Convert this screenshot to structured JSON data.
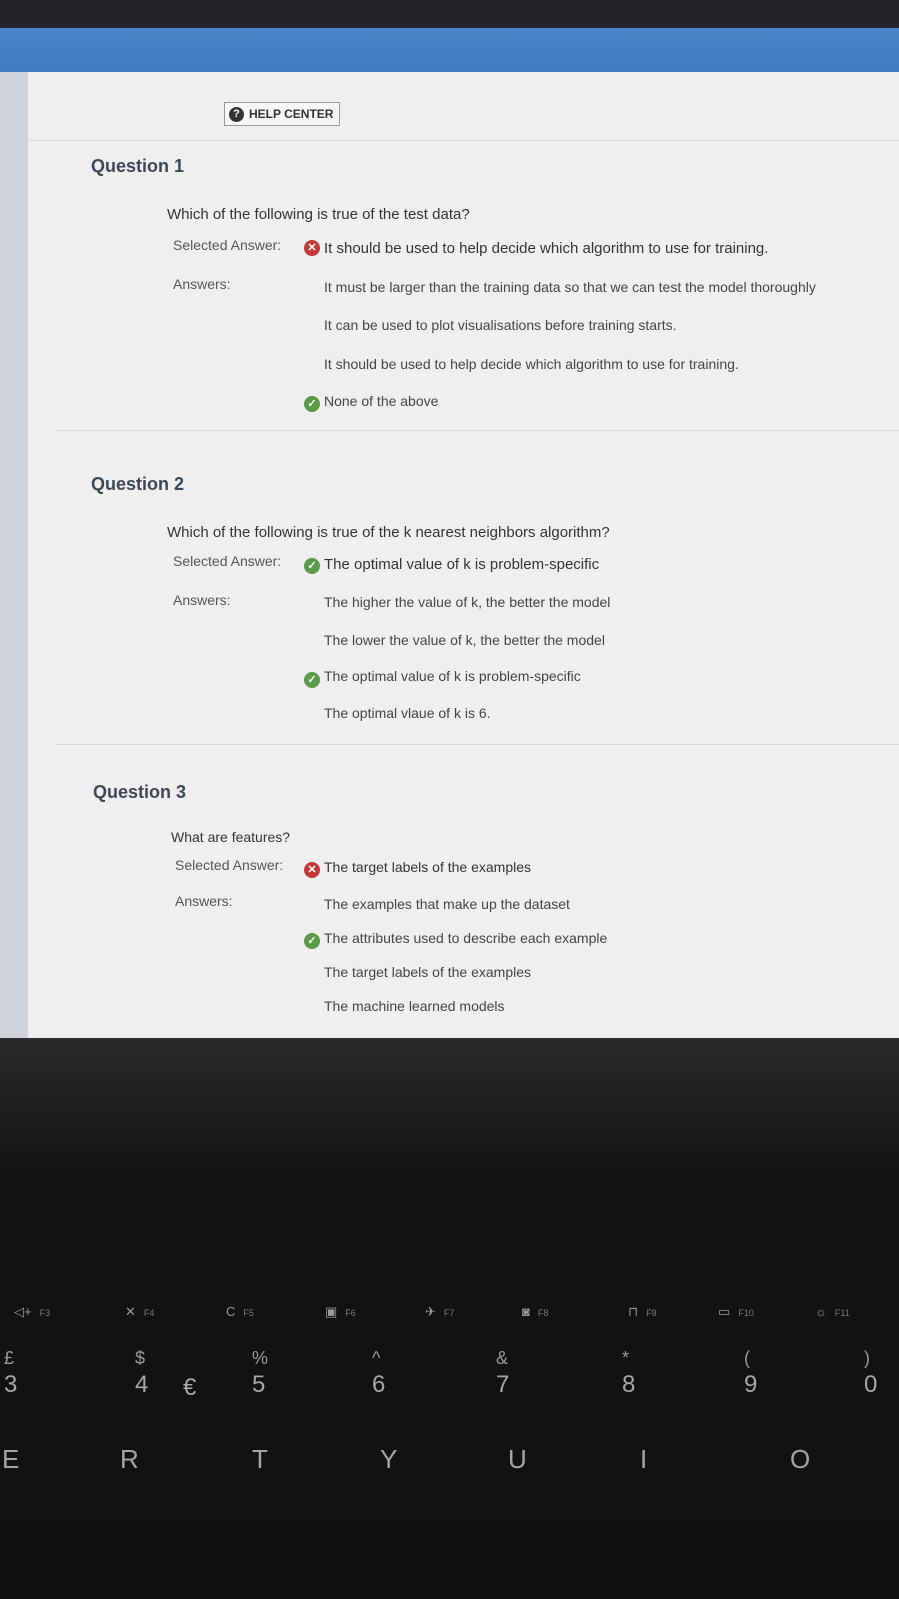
{
  "header": {
    "help_label": "HELP CENTER",
    "help_icon": "question-circle-icon"
  },
  "labels": {
    "selected": "Selected Answer:",
    "answers": "Answers:"
  },
  "icons": {
    "correct": "check-circle-icon",
    "incorrect": "x-circle-icon"
  },
  "colors": {
    "correct": "#5b9a48",
    "incorrect": "#c0393b",
    "banner": "#4b86c9"
  },
  "questions": [
    {
      "title": "Question 1",
      "text": "Which of the following is true of the test data?",
      "selected_answer": "It should be used to help decide which algorithm to use for training.",
      "selected_correct": false,
      "answers": [
        "It must be larger than the training data so that we can test the model thoroughly",
        "It can be used to plot visualisations before training starts.",
        "It should be used to help decide which algorithm to use for training.",
        "None of the above"
      ],
      "correct_index": 3
    },
    {
      "title": "Question 2",
      "text": "Which of the following is true of the k nearest neighbors algorithm?",
      "selected_answer": "The optimal value of k is problem-specific",
      "selected_correct": true,
      "answers": [
        "The higher the value of k, the better the model",
        "The lower the value of k, the better the model",
        "The optimal value of k is problem-specific",
        "The optimal vlaue of k is 6."
      ],
      "correct_index": 2
    },
    {
      "title": "Question 3",
      "text": "What are features?",
      "selected_answer": "The target labels of the examples",
      "selected_correct": false,
      "answers": [
        "The examples that make up the dataset",
        "The attributes used to describe each example",
        "The target labels of the examples",
        "The machine learned models"
      ],
      "correct_index": 1
    }
  ],
  "keyboard": {
    "fkeys": [
      "F3",
      "F4",
      "F5",
      "F6",
      "F7",
      "F8",
      "F9",
      "F10",
      "F11"
    ],
    "numbers": [
      {
        "sym": "£",
        "num": "3"
      },
      {
        "sym": "$",
        "num": "4"
      },
      {
        "sym": "%",
        "num": "5"
      },
      {
        "sym": "^",
        "num": "6"
      },
      {
        "sym": "&",
        "num": "7"
      },
      {
        "sym": "*",
        "num": "8"
      },
      {
        "sym": "(",
        "num": "9"
      },
      {
        "sym": ")",
        "num": "0"
      }
    ],
    "euro": "€",
    "letters": [
      "E",
      "R",
      "T",
      "Y",
      "U",
      "I",
      "O"
    ]
  }
}
